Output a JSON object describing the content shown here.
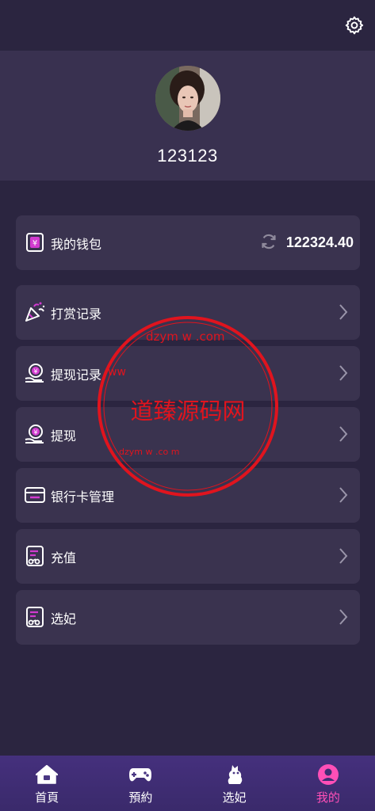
{
  "profile": {
    "username": "123123"
  },
  "wallet": {
    "label": "我的钱包",
    "balance": "122324.40"
  },
  "menu": [
    {
      "label": "打赏记录",
      "icon": "party-popper-icon"
    },
    {
      "label": "提现记录",
      "icon": "withdraw-record-icon"
    },
    {
      "label": "提现",
      "icon": "withdraw-icon"
    },
    {
      "label": "银行卡管理",
      "icon": "bank-card-icon"
    },
    {
      "label": "充值",
      "icon": "recharge-icon"
    },
    {
      "label": "选妃",
      "icon": "select-icon"
    }
  ],
  "tabs": [
    {
      "label": "首頁",
      "icon": "home-icon"
    },
    {
      "label": "預約",
      "icon": "gamepad-icon"
    },
    {
      "label": "选妃",
      "icon": "mascot-icon"
    },
    {
      "label": "我的",
      "icon": "user-icon"
    }
  ],
  "watermark": {
    "text": "道臻源码网",
    "ring_top": "dzym w .com",
    "ring_left": "ww",
    "ring_bottom": "dzym w .co m"
  },
  "colors": {
    "background": "#2b2540",
    "card": "#3a334f",
    "accent": "#ff4fb7",
    "tabbar": "#45307d",
    "watermark": "#e0141e"
  }
}
